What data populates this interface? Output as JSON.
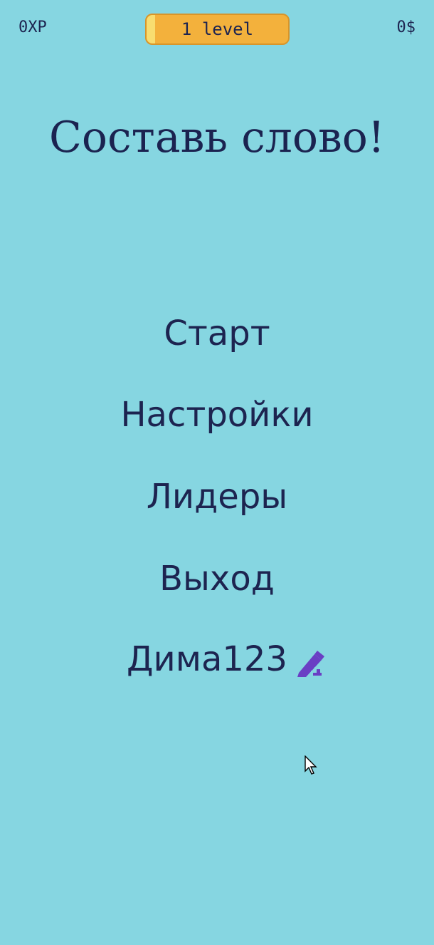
{
  "header": {
    "xp": "0XP",
    "level": "1 level",
    "level_progress": 0.06,
    "money": "0$"
  },
  "title": "Составь слово!",
  "menu": {
    "start": "Старт",
    "settings": "Настройки",
    "leaders": "Лидеры",
    "exit": "Выход"
  },
  "user": {
    "name": "Дима123",
    "edit_icon": "pencil-edit-icon"
  },
  "colors": {
    "background": "#86d6e1",
    "text": "#1d2450",
    "level_badge": "#f3b13c",
    "edit_icon": "#6a3fc4"
  }
}
